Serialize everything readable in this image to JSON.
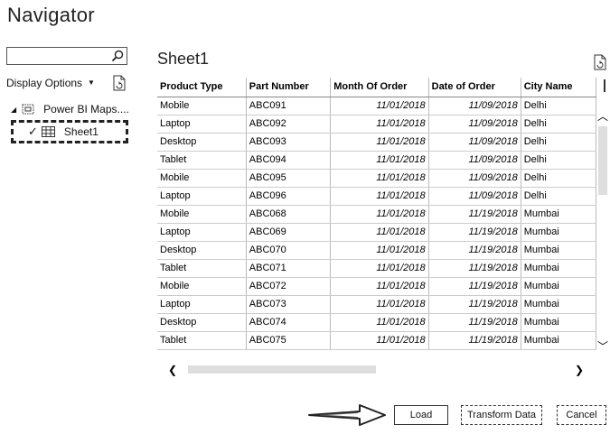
{
  "window": {
    "title": "Navigator"
  },
  "left_panel": {
    "search": {
      "value": "",
      "icon": "search-icon"
    },
    "display_options_label": "Display Options",
    "tree": {
      "root_label": "Power BI Maps....",
      "child_label": "Sheet1",
      "child_checked": true
    }
  },
  "preview": {
    "title": "Sheet1",
    "columns": [
      "Product Type",
      "Part Number",
      "Month Of Order",
      "Date of Order",
      "City Name"
    ],
    "rows": [
      [
        "Mobile",
        "ABC091",
        "11/01/2018",
        "11/09/2018",
        "Delhi"
      ],
      [
        "Laptop",
        "ABC092",
        "11/01/2018",
        "11/09/2018",
        "Delhi"
      ],
      [
        "Desktop",
        "ABC093",
        "11/01/2018",
        "11/09/2018",
        "Delhi"
      ],
      [
        "Tablet",
        "ABC094",
        "11/01/2018",
        "11/09/2018",
        "Delhi"
      ],
      [
        "Mobile",
        "ABC095",
        "11/01/2018",
        "11/09/2018",
        "Delhi"
      ],
      [
        "Laptop",
        "ABC096",
        "11/01/2018",
        "11/09/2018",
        "Delhi"
      ],
      [
        "Mobile",
        "ABC068",
        "11/01/2018",
        "11/19/2018",
        "Mumbai"
      ],
      [
        "Laptop",
        "ABC069",
        "11/01/2018",
        "11/19/2018",
        "Mumbai"
      ],
      [
        "Desktop",
        "ABC070",
        "11/01/2018",
        "11/19/2018",
        "Mumbai"
      ],
      [
        "Tablet",
        "ABC071",
        "11/01/2018",
        "11/19/2018",
        "Mumbai"
      ],
      [
        "Mobile",
        "ABC072",
        "11/01/2018",
        "11/19/2018",
        "Mumbai"
      ],
      [
        "Laptop",
        "ABC073",
        "11/01/2018",
        "11/19/2018",
        "Mumbai"
      ],
      [
        "Desktop",
        "ABC074",
        "11/01/2018",
        "11/19/2018",
        "Mumbai"
      ],
      [
        "Tablet",
        "ABC075",
        "11/01/2018",
        "11/19/2018",
        "Mumbai"
      ]
    ]
  },
  "footer": {
    "load_label": "Load",
    "transform_label": "Transform Data",
    "cancel_label": "Cancel"
  }
}
